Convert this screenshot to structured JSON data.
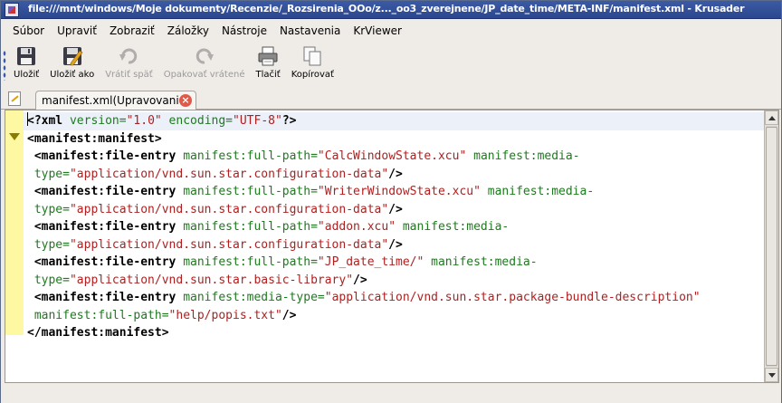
{
  "window": {
    "title": "file:///mnt/windows/Moje dokumenty/Recenzie/_Rozsirenia_OOo/z..._oo3_zverejnene/JP_date_time/META-INF/manifest.xml - Krusader"
  },
  "menu": {
    "items": [
      "Súbor",
      "Upraviť",
      "Zobraziť",
      "Záložky",
      "Nástroje",
      "Nastavenia",
      "KrViewer"
    ]
  },
  "toolbar": {
    "save_label": "Uložiť",
    "save_as_label": "Uložiť ako",
    "undo_label": "Vrátiť späť",
    "redo_label": "Opakovať vrátené",
    "print_label": "Tlačiť",
    "copy_label": "Kopírovať"
  },
  "tab": {
    "label": "manifest.xml(Upravovanie)"
  },
  "colors": {
    "tag": "#000000",
    "attribute": "#1e7a1e",
    "value": "#b01f1f",
    "gutter": "#fff8a3"
  },
  "editor": {
    "lines": [
      [
        {
          "t": "tag",
          "v": "<?xml"
        },
        {
          "t": "attr",
          "v": " version="
        },
        {
          "t": "val",
          "v": "\"1.0\""
        },
        {
          "t": "attr",
          "v": " encoding="
        },
        {
          "t": "val",
          "v": "\"UTF-8\""
        },
        {
          "t": "tag",
          "v": "?>"
        }
      ],
      [
        {
          "t": "tag",
          "v": "<manifest:manifest>"
        }
      ],
      [
        {
          "t": "txt",
          "v": " "
        },
        {
          "t": "tag",
          "v": "<manifest:file-entry"
        },
        {
          "t": "attr",
          "v": " manifest:full-path="
        },
        {
          "t": "val",
          "v": "\"CalcWindowState.xcu\""
        },
        {
          "t": "attr",
          "v": " manifest:media-"
        }
      ],
      [
        {
          "t": "attr",
          "v": " type="
        },
        {
          "t": "val",
          "v": "\"application/vnd.sun.star.configuration-data\""
        },
        {
          "t": "tag",
          "v": "/>"
        }
      ],
      [
        {
          "t": "txt",
          "v": " "
        },
        {
          "t": "tag",
          "v": "<manifest:file-entry"
        },
        {
          "t": "attr",
          "v": " manifest:full-path="
        },
        {
          "t": "val",
          "v": "\"WriterWindowState.xcu\""
        },
        {
          "t": "attr",
          "v": " manifest:media-"
        }
      ],
      [
        {
          "t": "attr",
          "v": " type="
        },
        {
          "t": "val",
          "v": "\"application/vnd.sun.star.configuration-data\""
        },
        {
          "t": "tag",
          "v": "/>"
        }
      ],
      [
        {
          "t": "txt",
          "v": " "
        },
        {
          "t": "tag",
          "v": "<manifest:file-entry"
        },
        {
          "t": "attr",
          "v": " manifest:full-path="
        },
        {
          "t": "val",
          "v": "\"addon.xcu\""
        },
        {
          "t": "attr",
          "v": " manifest:media-"
        }
      ],
      [
        {
          "t": "attr",
          "v": " type="
        },
        {
          "t": "val",
          "v": "\"application/vnd.sun.star.configuration-data\""
        },
        {
          "t": "tag",
          "v": "/>"
        }
      ],
      [
        {
          "t": "txt",
          "v": " "
        },
        {
          "t": "tag",
          "v": "<manifest:file-entry"
        },
        {
          "t": "attr",
          "v": " manifest:full-path="
        },
        {
          "t": "val",
          "v": "\"JP_date_time/\""
        },
        {
          "t": "attr",
          "v": " manifest:media-"
        }
      ],
      [
        {
          "t": "attr",
          "v": " type="
        },
        {
          "t": "val",
          "v": "\"application/vnd.sun.star.basic-library\""
        },
        {
          "t": "tag",
          "v": "/>"
        }
      ],
      [
        {
          "t": "txt",
          "v": " "
        },
        {
          "t": "tag",
          "v": "<manifest:file-entry"
        },
        {
          "t": "attr",
          "v": " manifest:media-type="
        },
        {
          "t": "val",
          "v": "\"application/vnd.sun.star.package-bundle-description\""
        }
      ],
      [
        {
          "t": "attr",
          "v": " manifest:full-path="
        },
        {
          "t": "val",
          "v": "\"help/popis.txt\""
        },
        {
          "t": "tag",
          "v": "/>"
        }
      ],
      [
        {
          "t": "tag",
          "v": "</manifest:manifest>"
        }
      ]
    ]
  }
}
